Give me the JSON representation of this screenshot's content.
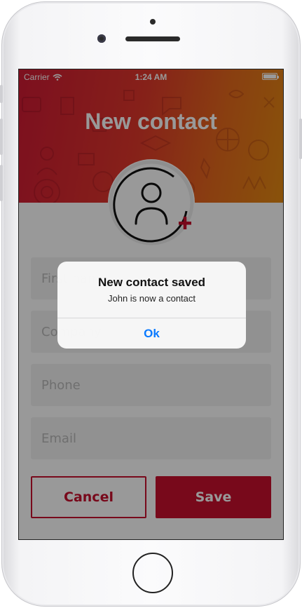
{
  "status_bar": {
    "carrier": "Carrier",
    "time": "1:24 AM"
  },
  "header": {
    "title": "New contact"
  },
  "form": {
    "first_name_placeholder": "First name",
    "company_placeholder": "Company",
    "phone_placeholder": "Phone",
    "email_placeholder": "Email",
    "cancel_label": "Cancel",
    "save_label": "Save"
  },
  "alert": {
    "title": "New contact saved",
    "message": "John is now a contact",
    "ok_label": "Ok"
  },
  "colors": {
    "brand_red": "#c8102e",
    "header_orange": "#e58a12",
    "link_blue": "#0a7aff"
  },
  "icons": [
    "wifi-icon",
    "battery-icon",
    "add-contact-avatar-icon",
    "plus-icon"
  ]
}
